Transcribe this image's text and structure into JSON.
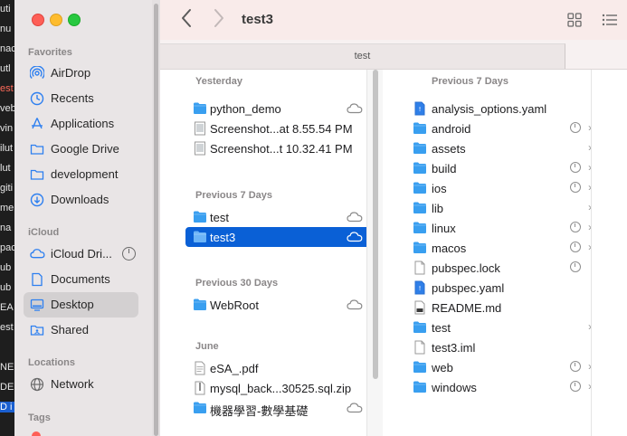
{
  "background_strip": [
    "uti",
    "nu",
    "nac",
    "utl",
    "est",
    "veb",
    "vin",
    "ilut",
    "lut",
    "giti",
    "me",
    "na",
    "pac",
    "ub",
    "ub",
    "EA",
    "est",
    "",
    "NE",
    "DEN",
    "D i"
  ],
  "sidebar": {
    "favorites_heading": "Favorites",
    "favorites": [
      {
        "label": "AirDrop",
        "icon": "airdrop-icon"
      },
      {
        "label": "Recents",
        "icon": "clock-icon"
      },
      {
        "label": "Applications",
        "icon": "applications-icon"
      },
      {
        "label": "Google Drive",
        "icon": "folder-icon"
      },
      {
        "label": "development",
        "icon": "folder-icon"
      },
      {
        "label": "Downloads",
        "icon": "download-icon"
      }
    ],
    "icloud_heading": "iCloud",
    "icloud": [
      {
        "label": "iCloud Dri...",
        "icon": "cloud-icon"
      },
      {
        "label": "Documents",
        "icon": "document-icon"
      },
      {
        "label": "Desktop",
        "icon": "desktop-icon",
        "selected": true
      },
      {
        "label": "Shared",
        "icon": "shared-folder-icon"
      }
    ],
    "locations_heading": "Locations",
    "locations": [
      {
        "label": "Network",
        "icon": "network-icon"
      }
    ],
    "tags_heading": "Tags"
  },
  "toolbar": {
    "title": "test3"
  },
  "pathbar": {
    "label": "test"
  },
  "column1": {
    "groups": [
      {
        "heading": "Yesterday",
        "items": [
          {
            "name": "python_demo",
            "type": "folder",
            "cloud": true,
            "chevron": true
          },
          {
            "name": "Screenshot...at 8.55.54 PM",
            "type": "image"
          },
          {
            "name": "Screenshot...t 10.32.41 PM",
            "type": "image"
          }
        ]
      },
      {
        "heading": "Previous 7 Days",
        "items": [
          {
            "name": "test",
            "type": "folder",
            "cloud": true,
            "chevron": true
          },
          {
            "name": "test3",
            "type": "folder",
            "cloud": true,
            "chevron": true,
            "selected": true
          }
        ]
      },
      {
        "heading": "Previous 30 Days",
        "items": [
          {
            "name": "WebRoot",
            "type": "folder",
            "cloud": true,
            "chevron": true
          }
        ]
      },
      {
        "heading": "June",
        "items": [
          {
            "name": "eSA_.pdf",
            "type": "pdf"
          },
          {
            "name": "mysql_back...30525.sql.zip",
            "type": "zip"
          },
          {
            "name": "機器學習-數學基礎",
            "type": "folder",
            "cloud": true,
            "chevron": true
          }
        ]
      }
    ]
  },
  "column2": {
    "heading": "Previous 7 Days",
    "items": [
      {
        "name": "analysis_options.yaml",
        "type": "yaml"
      },
      {
        "name": "android",
        "type": "folder",
        "progress": true,
        "chevron": true
      },
      {
        "name": "assets",
        "type": "folder",
        "chevron": true
      },
      {
        "name": "build",
        "type": "folder",
        "progress": true,
        "chevron": true
      },
      {
        "name": "ios",
        "type": "folder",
        "progress": true,
        "chevron": true
      },
      {
        "name": "lib",
        "type": "folder",
        "chevron": true
      },
      {
        "name": "linux",
        "type": "folder",
        "progress": true,
        "chevron": true
      },
      {
        "name": "macos",
        "type": "folder",
        "progress": true,
        "chevron": true
      },
      {
        "name": "pubspec.lock",
        "type": "doc",
        "progress": true
      },
      {
        "name": "pubspec.yaml",
        "type": "yaml"
      },
      {
        "name": "README.md",
        "type": "md"
      },
      {
        "name": "test",
        "type": "folder",
        "chevron": true
      },
      {
        "name": "test3.iml",
        "type": "doc"
      },
      {
        "name": "web",
        "type": "folder",
        "progress": true,
        "chevron": true
      },
      {
        "name": "windows",
        "type": "folder",
        "progress": true,
        "chevron": true
      }
    ]
  },
  "colors": {
    "accent": "#0a60d6",
    "folder": "#3a9ff0",
    "traffic_close": "#fe5f57",
    "traffic_min": "#febc2e",
    "traffic_max": "#28c840"
  }
}
